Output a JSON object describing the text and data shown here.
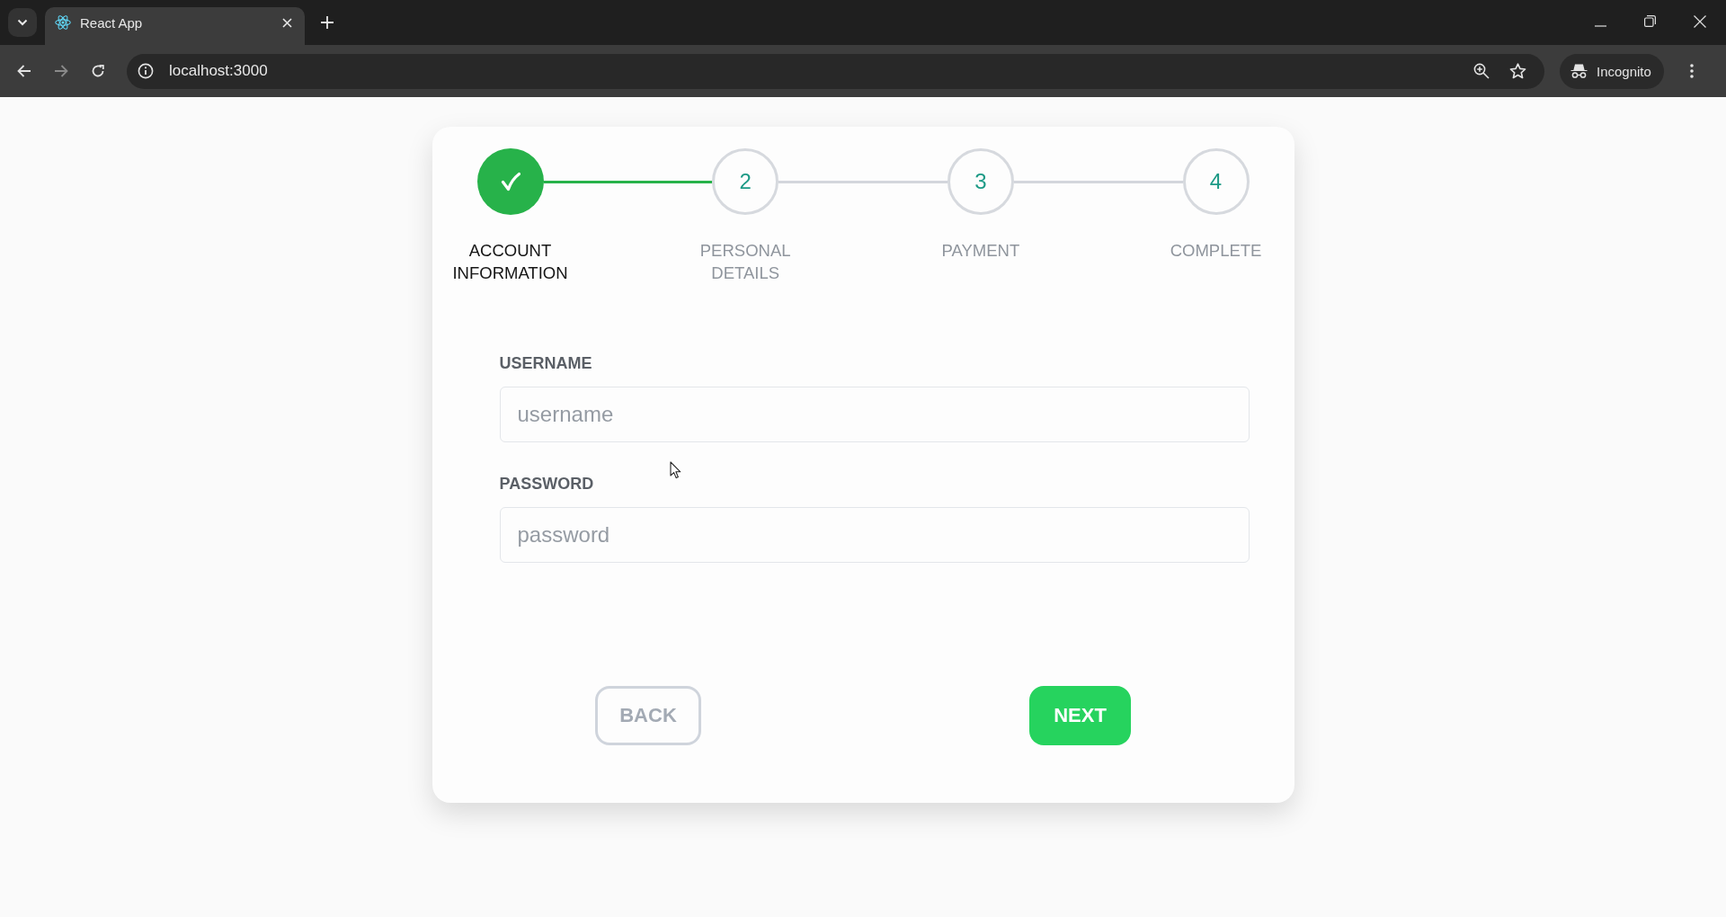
{
  "browser": {
    "tab": {
      "title": "React App"
    },
    "address": "localhost:3000",
    "profile": "Incognito"
  },
  "steps": [
    {
      "label": "ACCOUNT INFORMATION",
      "completed": true
    },
    {
      "number": "2",
      "label": "PERSONAL DETAILS",
      "completed": false
    },
    {
      "number": "3",
      "label": "PAYMENT",
      "completed": false
    },
    {
      "number": "4",
      "label": "COMPLETE",
      "completed": false
    }
  ],
  "fields": [
    {
      "label": "USERNAME",
      "placeholder": "username"
    },
    {
      "label": "PASSWORD",
      "placeholder": "password"
    }
  ],
  "buttons": [
    {
      "label": "BACK",
      "kind": "outline",
      "disabled": true
    },
    {
      "label": "NEXT",
      "kind": "primary",
      "disabled": false
    }
  ]
}
